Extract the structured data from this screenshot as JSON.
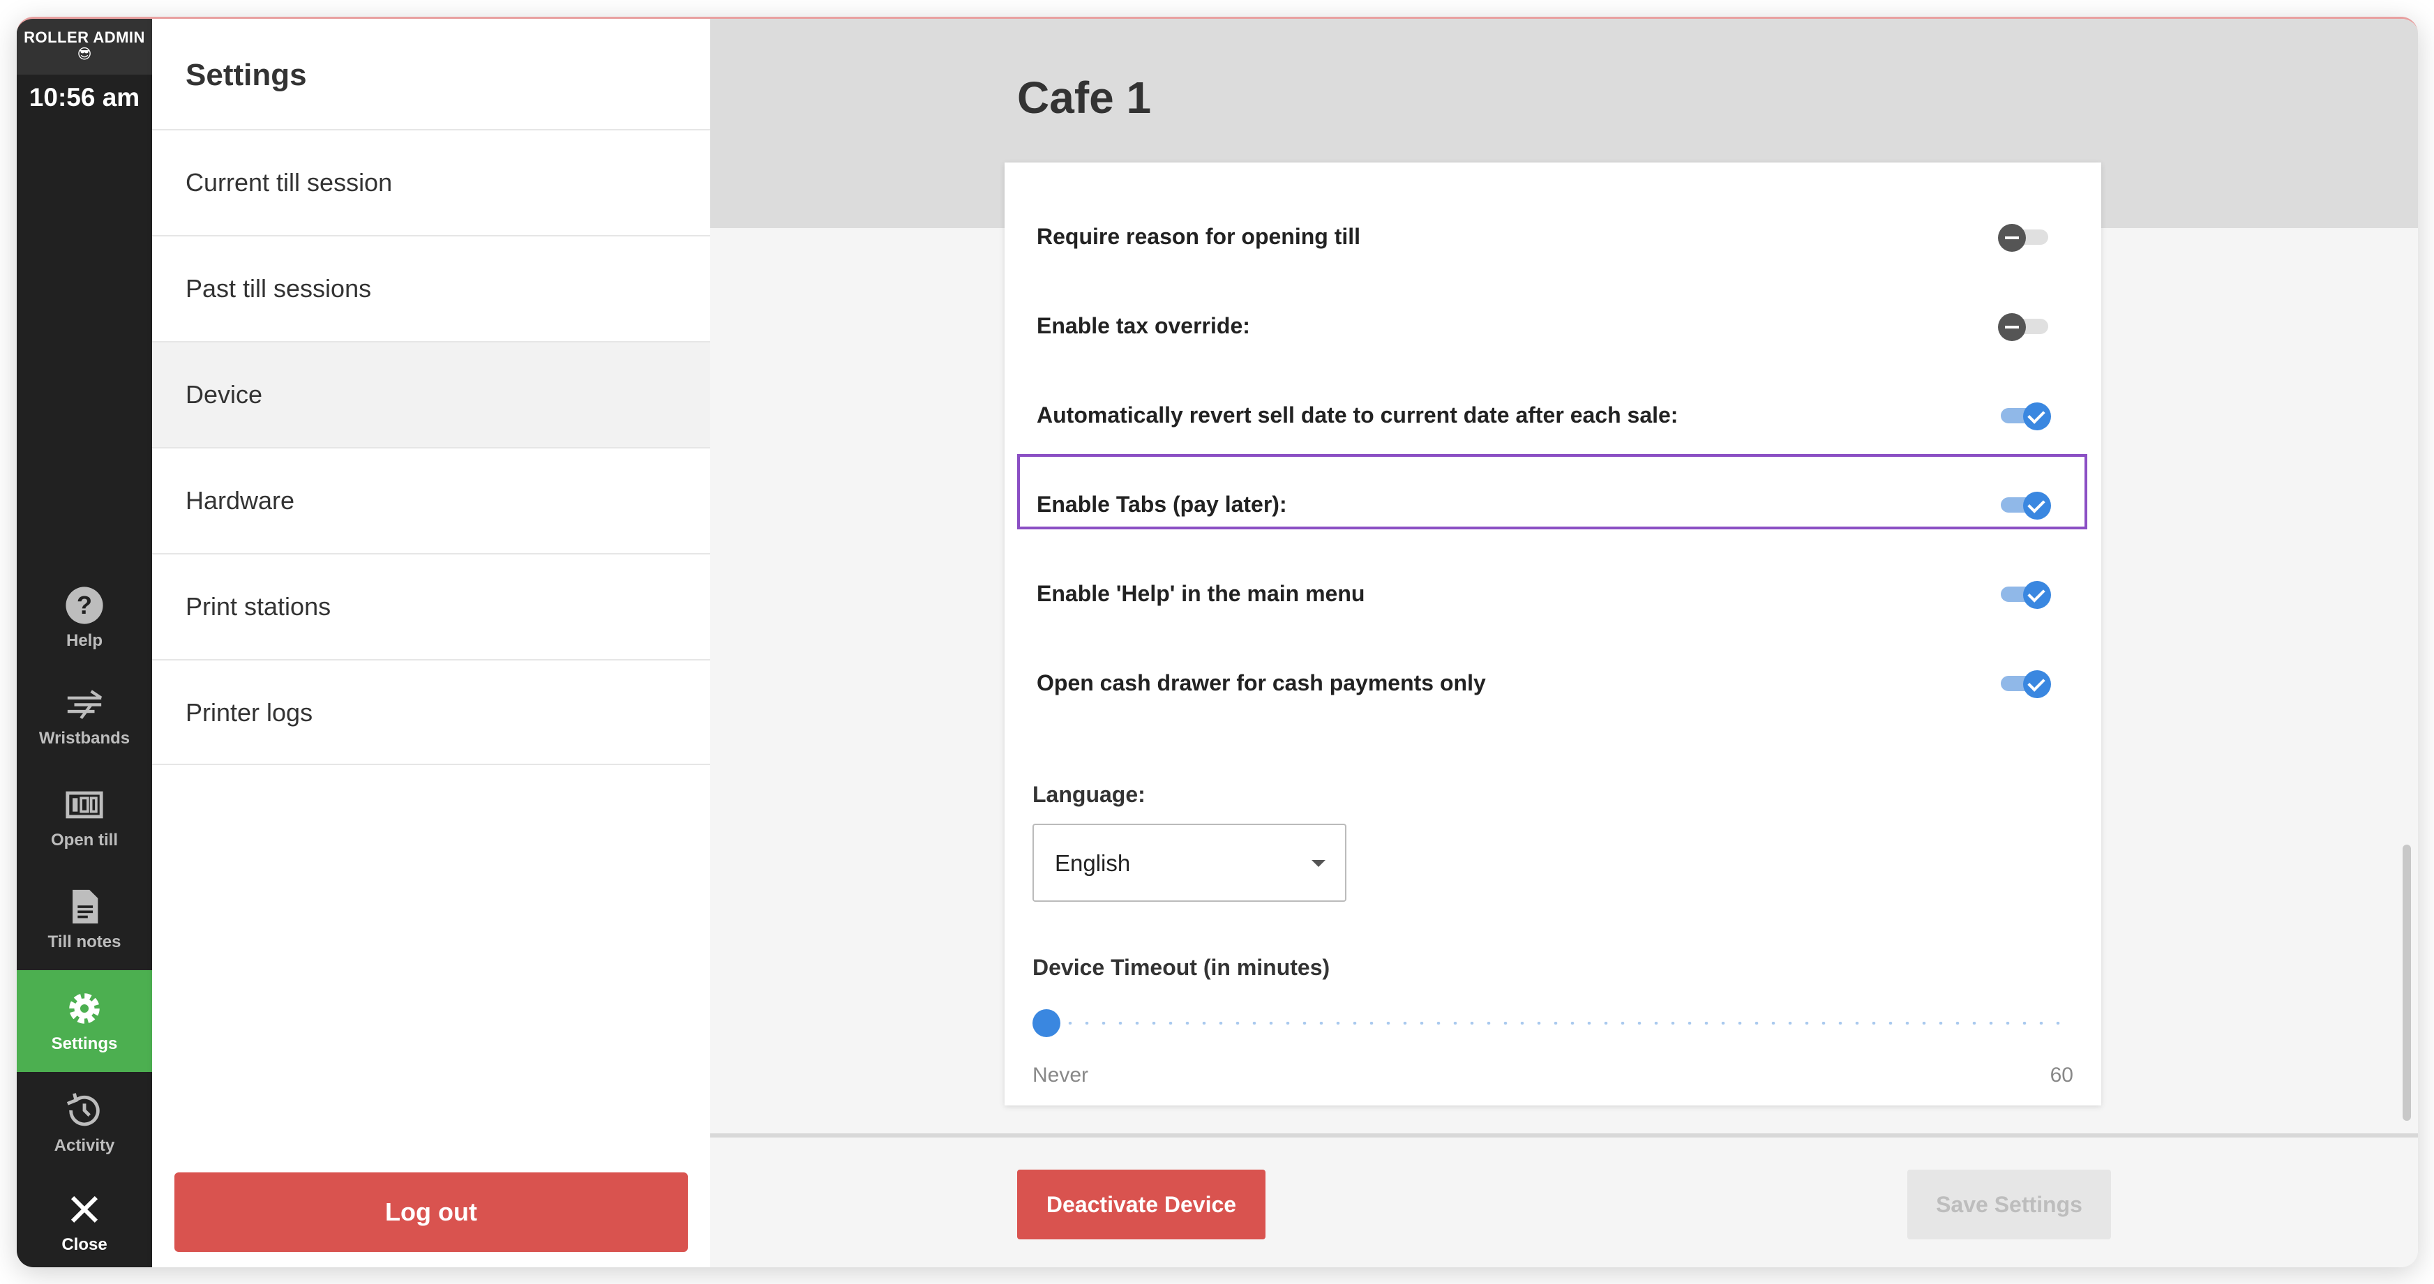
{
  "rail": {
    "brand": "ROLLER ADMIN",
    "emoji": "😎",
    "time": "10:56 am",
    "items": [
      {
        "label": "Help",
        "icon": "help-icon"
      },
      {
        "label": "Wristbands",
        "icon": "wristband-icon"
      },
      {
        "label": "Open till",
        "icon": "till-icon"
      },
      {
        "label": "Till notes",
        "icon": "note-icon"
      },
      {
        "label": "Settings",
        "icon": "gear-icon",
        "active": true
      },
      {
        "label": "Activity",
        "icon": "history-icon"
      },
      {
        "label": "Close",
        "icon": "close-icon"
      }
    ],
    "active_color": "#4caf50"
  },
  "panel": {
    "title": "Settings",
    "items": [
      "Current till session",
      "Past till sessions",
      "Device",
      "Hardware",
      "Print stations",
      "Printer logs"
    ],
    "selected": "Device",
    "logout_label": "Log out"
  },
  "main": {
    "title": "Cafe 1",
    "settings": [
      {
        "label": "Require reason for opening till",
        "enabled": false
      },
      {
        "label": "Enable tax override:",
        "enabled": false
      },
      {
        "label": "Automatically revert sell date to current date after each sale:",
        "enabled": true
      },
      {
        "label": "Enable Tabs (pay later):",
        "enabled": true,
        "highlighted": true
      },
      {
        "label": "Enable 'Help' in the main menu",
        "enabled": true
      },
      {
        "label": "Open cash drawer for cash payments only",
        "enabled": true
      }
    ],
    "language": {
      "label": "Language:",
      "value": "English"
    },
    "timeout": {
      "label": "Device Timeout (in minutes)",
      "min_label": "Never",
      "max_label": "60",
      "value": 0
    },
    "deactivate_label": "Deactivate Device",
    "save_label": "Save Settings",
    "colors": {
      "danger": "#d9534f",
      "toggle_on": "#3a87e0",
      "highlight": "#8b4fc4"
    }
  }
}
